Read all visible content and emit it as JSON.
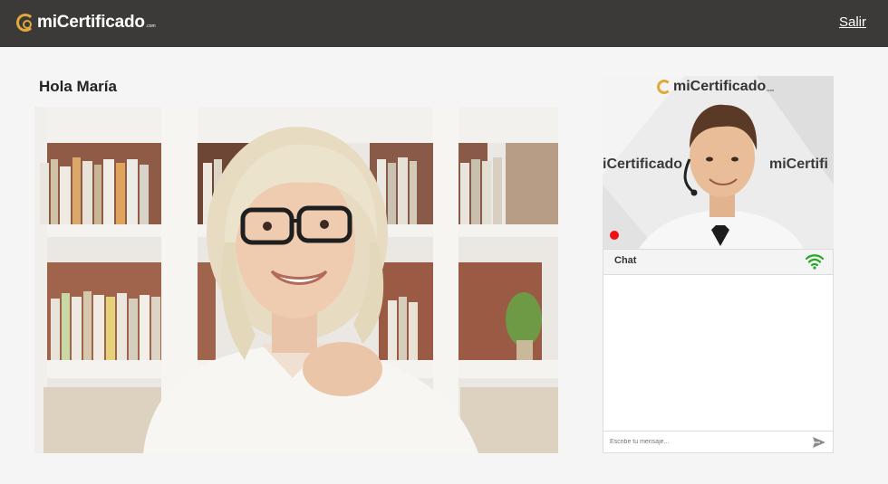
{
  "header": {
    "logo_text": "miCertificado",
    "logo_suffix": ".com",
    "exit_label": "Salir"
  },
  "greeting": "Hola María",
  "side_video": {
    "logo_text": "miCertificado",
    "logo_suffix": ".com",
    "banner_text_left": "iCertificado",
    "banner_text_right": "miCertifi"
  },
  "chat": {
    "title": "Chat",
    "input_placeholder": "Escribe tu mensaje..."
  },
  "colors": {
    "topbar": "#3b3a38",
    "brand_accent": "#e0a93a",
    "connection_ok": "#22aa22",
    "recording": "#ee1111"
  },
  "icons": [
    "logo-mark-icon",
    "wifi-icon",
    "send-icon",
    "recording-dot-icon"
  ]
}
